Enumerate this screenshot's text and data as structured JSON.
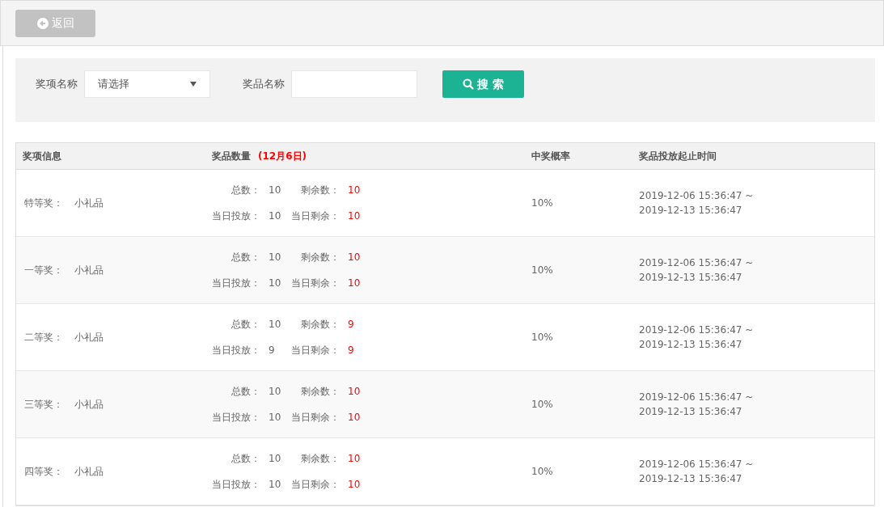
{
  "back_button": {
    "label": "返回"
  },
  "filters": {
    "award_label": "奖项名称",
    "award_select": {
      "value": "请选择"
    },
    "prize_label": "奖品名称",
    "search_button": {
      "label": "搜 索"
    }
  },
  "table": {
    "columns": [
      {
        "label": "奖项信息"
      },
      {
        "label": "奖品数量",
        "note": "(12月6日)"
      },
      {
        "label": "中奖概率"
      },
      {
        "label": "奖品投放起止时间"
      }
    ],
    "rows": [
      {
        "award": "特等奖：",
        "prize": "小礼品",
        "stats": [
          {
            "label": "总数：",
            "value": "10",
            "highlight": false
          },
          {
            "label": "剩余数：",
            "value": "10",
            "highlight": true
          },
          {
            "label": "当日投放：",
            "value": "10",
            "highlight": false
          },
          {
            "label": "当日剩余：",
            "value": "10",
            "highlight": true
          }
        ],
        "rate": "10%",
        "start": "2019-12-06 15:36:47 ~",
        "end": "2019-12-13 15:36:47"
      },
      {
        "award": "一等奖：",
        "prize": "小礼品",
        "stats": [
          {
            "label": "总数：",
            "value": "10",
            "highlight": false
          },
          {
            "label": "剩余数：",
            "value": "10",
            "highlight": true
          },
          {
            "label": "当日投放：",
            "value": "10",
            "highlight": false
          },
          {
            "label": "当日剩余：",
            "value": "10",
            "highlight": true
          }
        ],
        "rate": "10%",
        "start": "2019-12-06 15:36:47 ~",
        "end": "2019-12-13 15:36:47"
      },
      {
        "award": "二等奖：",
        "prize": "小礼品",
        "stats": [
          {
            "label": "总数：",
            "value": "10",
            "highlight": false
          },
          {
            "label": "剩余数：",
            "value": "9",
            "highlight": true
          },
          {
            "label": "当日投放：",
            "value": "9",
            "highlight": false
          },
          {
            "label": "当日剩余：",
            "value": "9",
            "highlight": true
          }
        ],
        "rate": "10%",
        "start": "2019-12-06 15:36:47 ~",
        "end": "2019-12-13 15:36:47"
      },
      {
        "award": "三等奖：",
        "prize": "小礼品",
        "stats": [
          {
            "label": "总数：",
            "value": "10",
            "highlight": false
          },
          {
            "label": "剩余数：",
            "value": "10",
            "highlight": true
          },
          {
            "label": "当日投放：",
            "value": "10",
            "highlight": false
          },
          {
            "label": "当日剩余：",
            "value": "10",
            "highlight": true
          }
        ],
        "rate": "10%",
        "start": "2019-12-06 15:36:47 ~",
        "end": "2019-12-13 15:36:47"
      },
      {
        "award": "四等奖：",
        "prize": "小礼品",
        "stats": [
          {
            "label": "总数：",
            "value": "10",
            "highlight": false
          },
          {
            "label": "剩余数：",
            "value": "10",
            "highlight": true
          },
          {
            "label": "当日投放：",
            "value": "10",
            "highlight": false
          },
          {
            "label": "当日剩余：",
            "value": "10",
            "highlight": true
          }
        ],
        "rate": "10%",
        "start": "2019-12-06 15:36:47 ~",
        "end": "2019-12-13 15:36:47"
      }
    ]
  }
}
